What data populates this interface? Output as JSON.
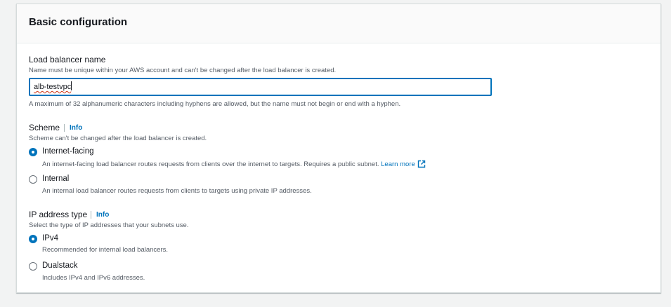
{
  "panel": {
    "title": "Basic configuration"
  },
  "load_balancer_name": {
    "label": "Load balancer name",
    "description": "Name must be unique within your AWS account and can't be changed after the load balancer is created.",
    "value": "alb-testvpc",
    "constraint": "A maximum of 32 alphanumeric characters including hyphens are allowed, but the name must not begin or end with a hyphen."
  },
  "scheme": {
    "label": "Scheme",
    "info": "Info",
    "description": "Scheme can't be changed after the load balancer is created.",
    "options": [
      {
        "label": "Internet-facing",
        "description": "An internet-facing load balancer routes requests from clients over the internet to targets. Requires a public subnet.",
        "link": "Learn more",
        "selected": true
      },
      {
        "label": "Internal",
        "description": "An internal load balancer routes requests from clients to targets using private IP addresses.",
        "selected": false
      }
    ]
  },
  "ip_address_type": {
    "label": "IP address type",
    "info": "Info",
    "description": "Select the type of IP addresses that your subnets use.",
    "options": [
      {
        "label": "IPv4",
        "description": "Recommended for internal load balancers.",
        "selected": true
      },
      {
        "label": "Dualstack",
        "description": "Includes IPv4 and IPv6 addresses.",
        "selected": false
      }
    ]
  },
  "icons": {
    "external_link": "external-link-icon"
  },
  "colors": {
    "accent": "#0073bb",
    "text": "#16191f",
    "secondary_text": "#545b64",
    "spellcheck_error": "#d13212"
  }
}
